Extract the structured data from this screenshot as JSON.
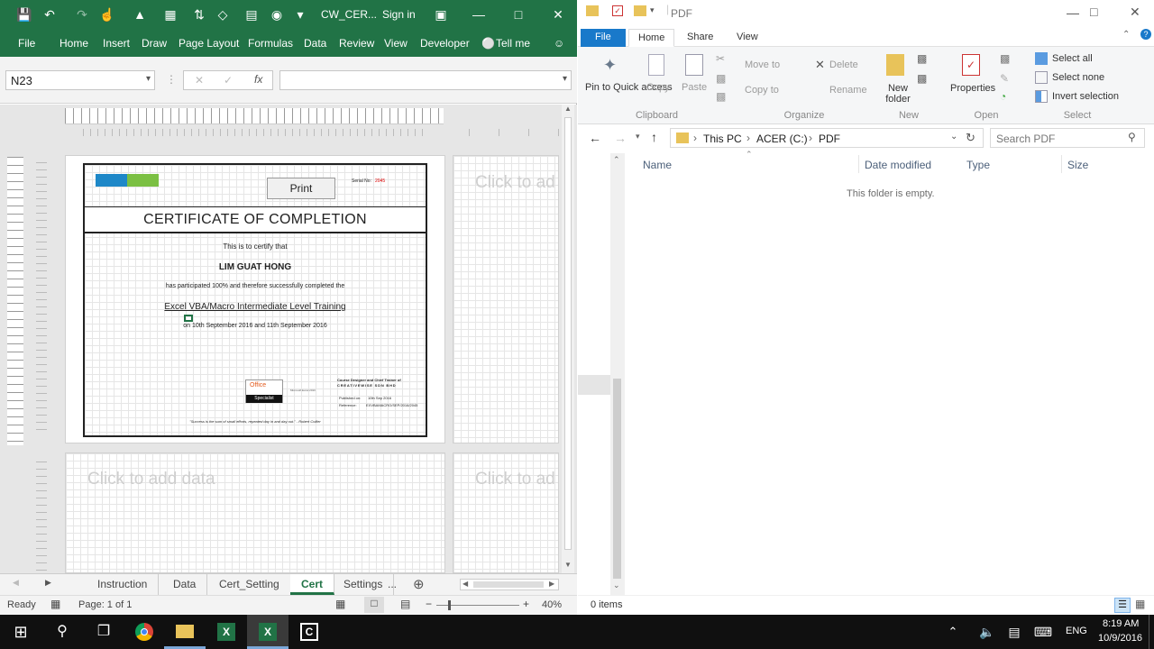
{
  "excel": {
    "window_title": "CW_CER...",
    "sign_in": "Sign in",
    "ribbon_tabs": [
      "File",
      "Home",
      "Insert",
      "Draw",
      "Page Layout",
      "Formulas",
      "Data",
      "Review",
      "View",
      "Developer",
      "Tell me"
    ],
    "name_box": "N23",
    "fx_label": "fx",
    "certificate": {
      "print_label": "Print",
      "serial_label": "Serial No:",
      "serial_value": "2045",
      "heading": "CERTIFICATE OF COMPLETION",
      "line1": "This is to certify that",
      "name": "LIM GUAT HONG",
      "line2": "has participated 100% and therefore successfully completed the",
      "course": "Excel VBA/Macro Intermediate Level Training",
      "dates": "on 10th September 2016 and 11th September 2016",
      "logo_office": "Office",
      "logo_specialist": "Specialist",
      "ms_excel": "Microsoft Excel 2010",
      "trainer_line1": "Course Designer and Chief Trainer of",
      "trainer_line2": "CREATIVEWISE SDN BHD",
      "published_label": "Published on:",
      "published_value": "10th Sep 2016",
      "ref_label": "Reference:",
      "ref_value": "EXVBAMACRO/SEP/2016/2045",
      "quote": "\"Success is the sum of small efforts, repeated day in and day out.\" - Robert Collier"
    },
    "placeholder": "Click to add data",
    "placeholder_short": "Click to ad",
    "sheet_tabs": [
      "Instruction",
      "Data",
      "Cert_Setting",
      "Cert",
      "Settings",
      "..."
    ],
    "active_sheet": "Cert",
    "status_ready": "Ready",
    "status_page": "Page: 1 of 1",
    "zoom": "40%"
  },
  "explorer": {
    "title": "PDF",
    "ribbon_tabs": [
      "File",
      "Home",
      "Share",
      "View"
    ],
    "clipboard": {
      "pin": "Pin to Quick access",
      "copy": "Copy",
      "paste": "Paste",
      "label": "Clipboard"
    },
    "organize": {
      "move_to": "Move to",
      "copy_to": "Copy to",
      "delete": "Delete",
      "rename": "Rename",
      "label": "Organize"
    },
    "new": {
      "new_folder": "New folder",
      "label": "New"
    },
    "open": {
      "properties": "Properties",
      "label": "Open"
    },
    "select": {
      "select_all": "Select all",
      "select_none": "Select none",
      "invert": "Invert selection",
      "label": "Select"
    },
    "breadcrumb": [
      "This PC",
      "ACER (C:)",
      "PDF"
    ],
    "search_placeholder": "Search PDF",
    "columns": [
      "Name",
      "Date modified",
      "Type",
      "Size"
    ],
    "empty_message": "This folder is empty.",
    "item_count": "0 items"
  },
  "taskbar": {
    "language": "ENG",
    "time": "8:19 AM",
    "date": "10/9/2016"
  },
  "colors": {
    "excel_green": "#217346",
    "explorer_blue": "#1979ca",
    "taskbar": "#101010"
  }
}
